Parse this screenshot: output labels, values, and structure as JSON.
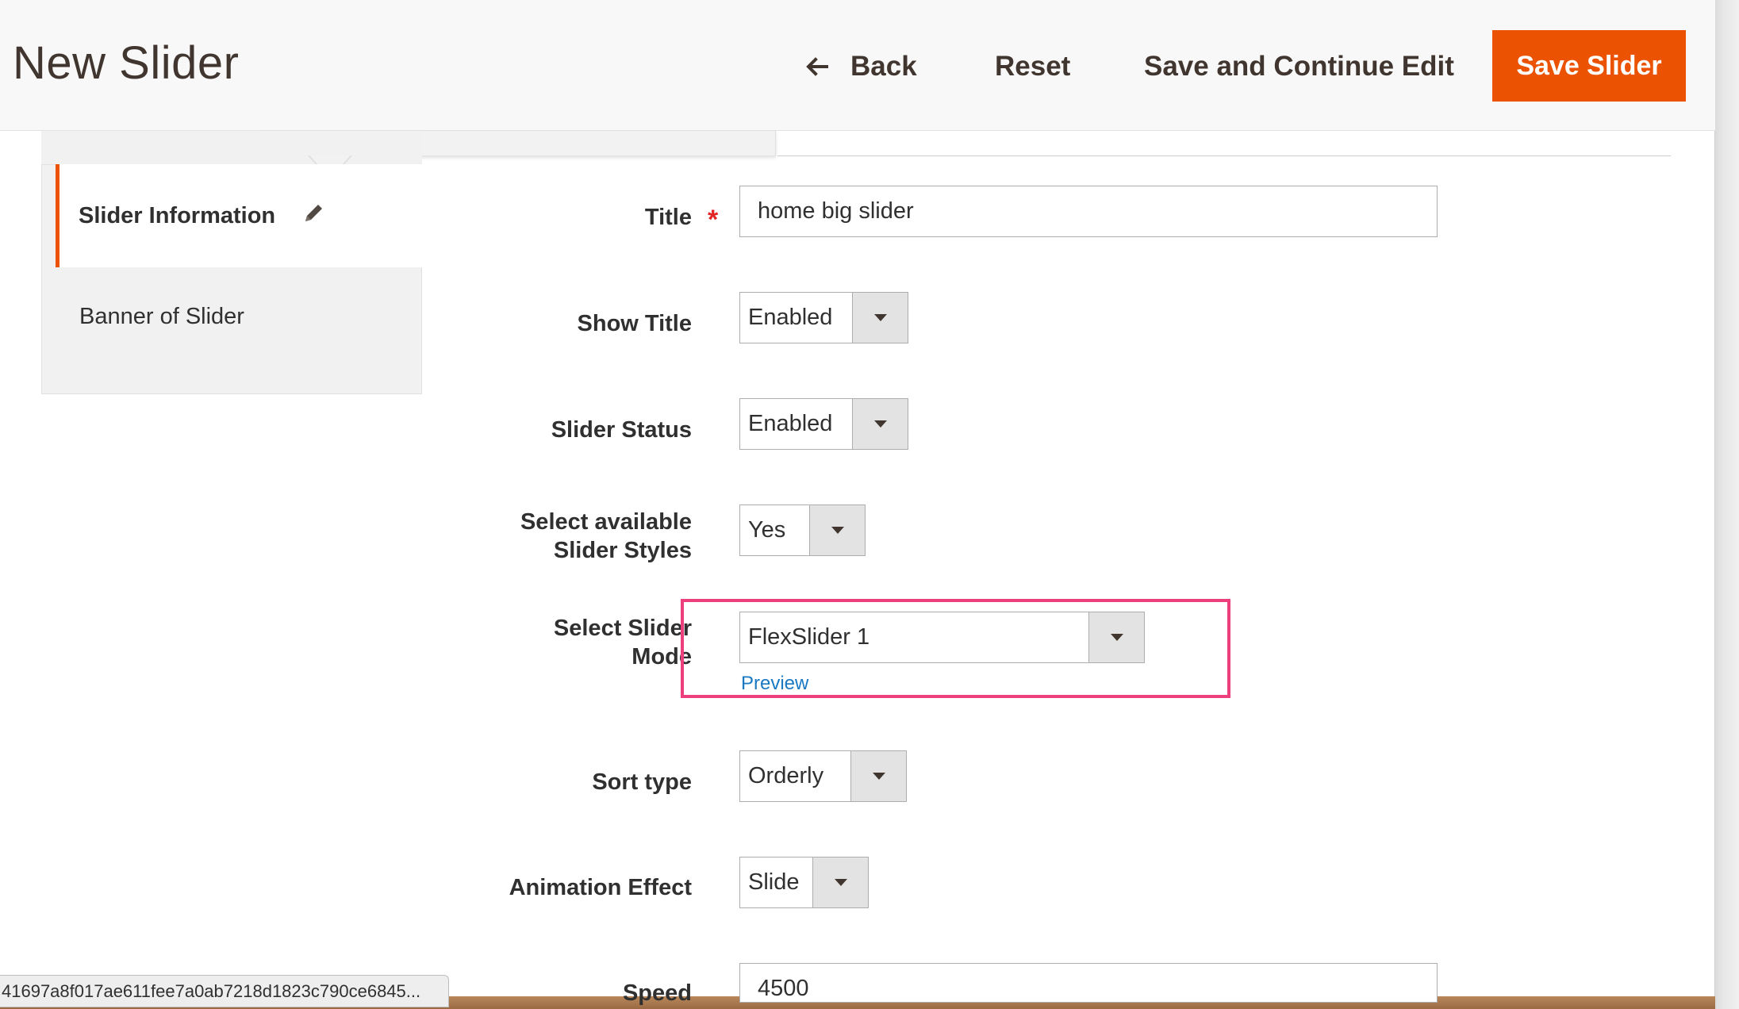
{
  "header": {
    "title": "New Slider",
    "back_label": "Back",
    "reset_label": "Reset",
    "save_continue_label": "Save and Continue Edit",
    "save_label": "Save Slider"
  },
  "tabs": {
    "items": [
      {
        "label": "Slider Information",
        "active": true,
        "icon": "pencil-icon"
      },
      {
        "label": "Banner of Slider",
        "active": false
      }
    ]
  },
  "form": {
    "title": {
      "label": "Title",
      "value": "home big slider",
      "required_mark": "*"
    },
    "show_title": {
      "label": "Show Title",
      "value": "Enabled"
    },
    "slider_status": {
      "label": "Slider Status",
      "value": "Enabled"
    },
    "styles": {
      "label_line1": "Select available",
      "label_line2": "Slider Styles",
      "value": "Yes"
    },
    "slider_mode": {
      "label_line1": "Select Slider",
      "label_line2": "Mode",
      "value": "FlexSlider 1",
      "preview_label": "Preview"
    },
    "sort_type": {
      "label": "Sort type",
      "value": "Orderly"
    },
    "animation_effect": {
      "label": "Animation Effect",
      "value": "Slide"
    },
    "speed": {
      "label": "Speed",
      "value": "4500"
    }
  },
  "status_bar": {
    "url": "41697a8f017ae611fee7a0ab7218d1823c790ce6845..."
  },
  "colors": {
    "accent": "#eb5202",
    "highlight": "#ee3f7d",
    "link": "#1979c3",
    "required": "#e22626"
  }
}
